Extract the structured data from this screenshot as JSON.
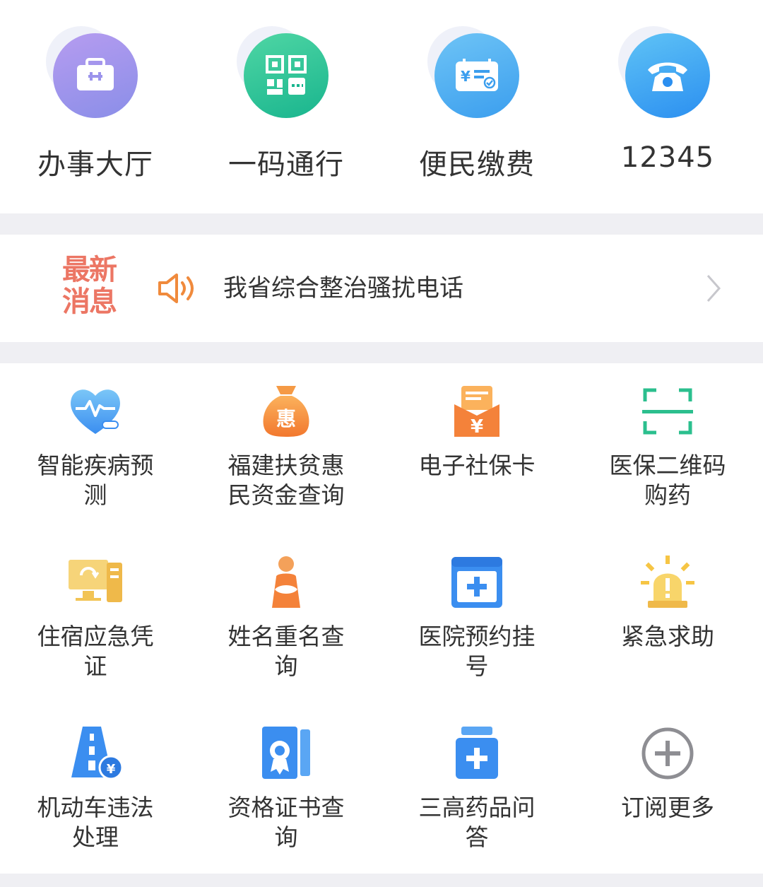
{
  "top_services": [
    {
      "label": "办事大厅",
      "icon": "briefcase-icon",
      "color_from": "#b69cf0",
      "color_to": "#8a8ee8"
    },
    {
      "label": "一码通行",
      "icon": "qr-code-icon",
      "color_from": "#4fd6a4",
      "color_to": "#19b58e"
    },
    {
      "label": "便民缴费",
      "icon": "bill-payment-icon",
      "color_from": "#6ec4f6",
      "color_to": "#3b9eee"
    },
    {
      "label": "12345",
      "icon": "phone-icon",
      "color_from": "#5fc3f6",
      "color_to": "#2b8ff0"
    }
  ],
  "news": {
    "tag": "最新消息",
    "tag_line1": "最新",
    "tag_line2": "消息",
    "headline": "我省综合整治骚扰电话",
    "tag_color": "#ec7664",
    "speaker_color": "#f08a3c"
  },
  "services": [
    {
      "label": "智能疾病预测",
      "icon": "heart-pulse-icon"
    },
    {
      "label": "福建扶贫惠民资金查询",
      "icon": "money-bag-icon"
    },
    {
      "label": "电子社保卡",
      "icon": "social-security-card-icon"
    },
    {
      "label": "医保二维码购药",
      "icon": "scan-frame-icon"
    },
    {
      "label": "住宿应急凭证",
      "icon": "computer-refresh-icon"
    },
    {
      "label": "姓名重名查询",
      "icon": "person-icon"
    },
    {
      "label": "医院预约挂号",
      "icon": "medical-calendar-icon"
    },
    {
      "label": "紧急求助",
      "icon": "alarm-siren-icon"
    },
    {
      "label": "机动车违法处理",
      "icon": "road-fine-icon"
    },
    {
      "label": "资格证书查询",
      "icon": "certificate-icon"
    },
    {
      "label": "三高药品问答",
      "icon": "medicine-bottle-icon"
    },
    {
      "label": "订阅更多",
      "icon": "add-circle-icon"
    }
  ]
}
